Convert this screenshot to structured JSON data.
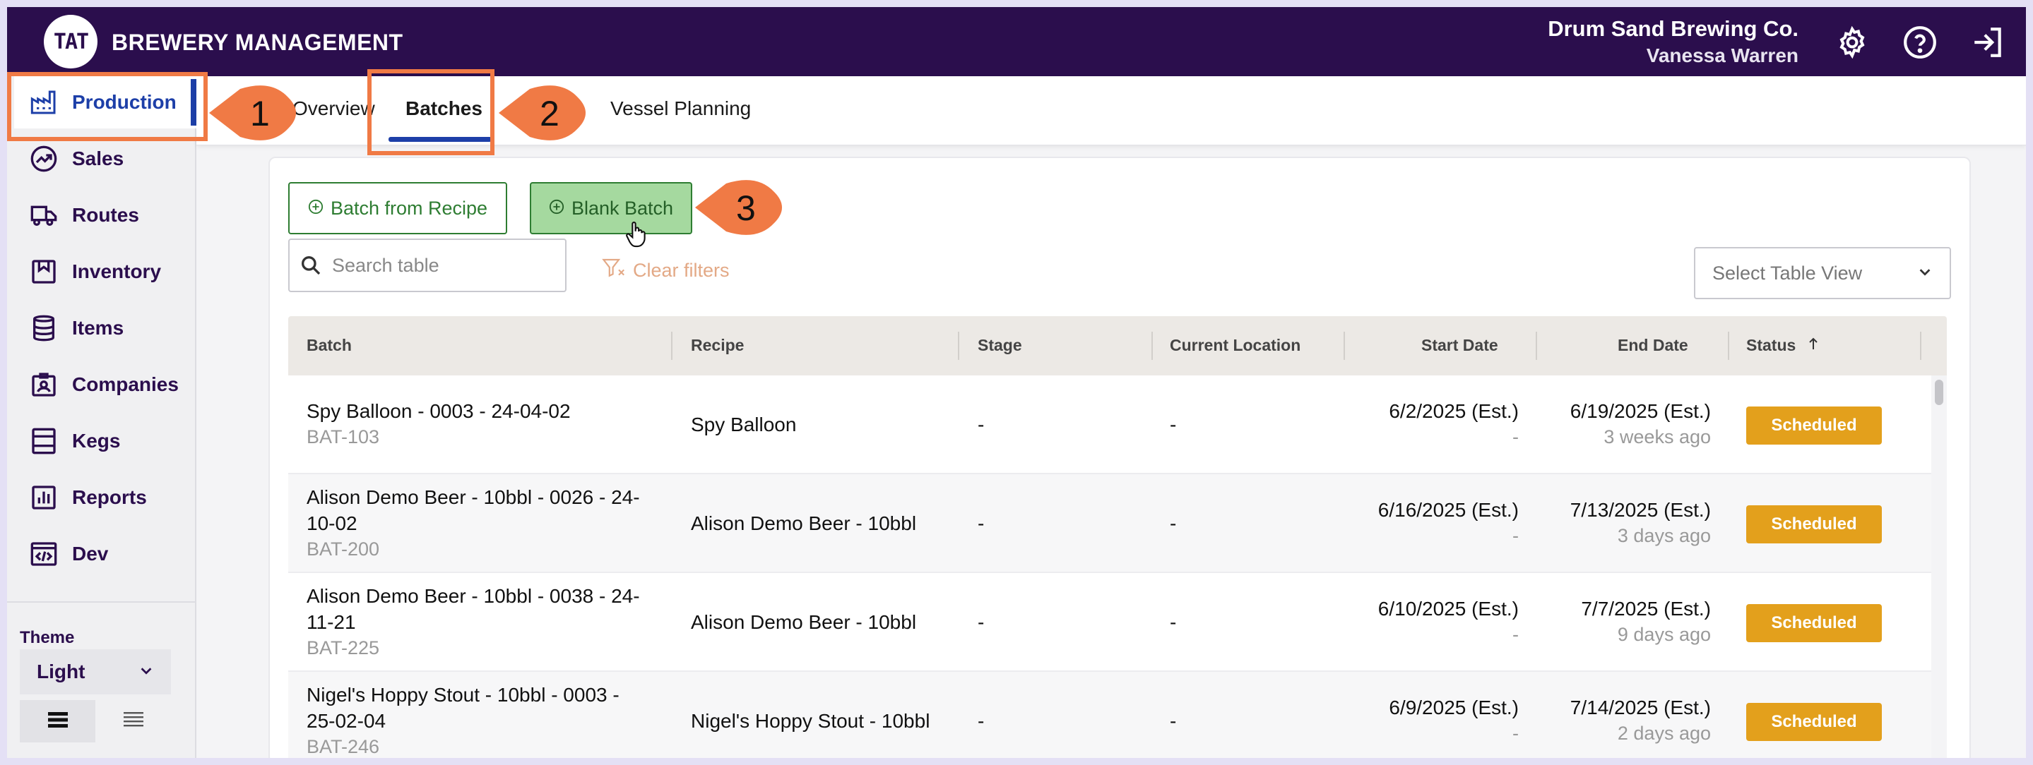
{
  "header": {
    "logo_text": "TAT",
    "app_title": "BREWERY MANAGEMENT",
    "company": "Drum Sand Brewing Co.",
    "user": "Vanessa Warren",
    "icons": [
      "settings-gear-icon",
      "help-question-icon",
      "logout-icon"
    ]
  },
  "sidebar": {
    "items": [
      {
        "label": "Production",
        "icon": "factory-icon"
      },
      {
        "label": "Sales",
        "icon": "trending-icon"
      },
      {
        "label": "Routes",
        "icon": "truck-icon"
      },
      {
        "label": "Inventory",
        "icon": "bookmark-box-icon"
      },
      {
        "label": "Items",
        "icon": "barrel-icon"
      },
      {
        "label": "Companies",
        "icon": "contact-card-icon"
      },
      {
        "label": "Kegs",
        "icon": "keg-icon"
      },
      {
        "label": "Reports",
        "icon": "bar-chart-icon"
      },
      {
        "label": "Dev",
        "icon": "code-window-icon"
      }
    ],
    "theme_label": "Theme",
    "theme_value": "Light"
  },
  "tabs": {
    "overview": "Overview",
    "batches": "Batches",
    "vessel_planning": "Vessel Planning"
  },
  "toolbar": {
    "batch_from_recipe": "Batch from Recipe",
    "blank_batch": "Blank Batch",
    "search_placeholder": "Search table",
    "clear_filters": "Clear filters",
    "table_view_placeholder": "Select Table View"
  },
  "table": {
    "columns": [
      "Batch",
      "Recipe",
      "Stage",
      "Current Location",
      "Start Date",
      "End Date",
      "Status"
    ],
    "rows": [
      {
        "batch_l1": "Spy Balloon - 0003 - 24-04-02",
        "batch_l2": "",
        "batch_id": "BAT-103",
        "recipe": "Spy Balloon",
        "stage": "-",
        "location": "-",
        "start": "6/2/2025 (Est.)",
        "start_sub": "-",
        "end": "6/19/2025 (Est.)",
        "end_sub": "3 weeks ago",
        "status": "Scheduled"
      },
      {
        "batch_l1": "Alison Demo Beer - 10bbl - 0026 - 24-",
        "batch_l2": "10-02",
        "batch_id": "BAT-200",
        "recipe": "Alison Demo Beer - 10bbl",
        "stage": "-",
        "location": "-",
        "start": "6/16/2025 (Est.)",
        "start_sub": "-",
        "end": "7/13/2025 (Est.)",
        "end_sub": "3 days ago",
        "status": "Scheduled"
      },
      {
        "batch_l1": "Alison Demo Beer - 10bbl - 0038 - 24-",
        "batch_l2": "11-21",
        "batch_id": "BAT-225",
        "recipe": "Alison Demo Beer - 10bbl",
        "stage": "-",
        "location": "-",
        "start": "6/10/2025 (Est.)",
        "start_sub": "-",
        "end": "7/7/2025 (Est.)",
        "end_sub": "9 days ago",
        "status": "Scheduled"
      },
      {
        "batch_l1": "Nigel's Hoppy Stout - 10bbl - 0003 -",
        "batch_l2": "25-02-04",
        "batch_id": "BAT-246",
        "recipe": "Nigel's Hoppy Stout - 10bbl",
        "stage": "-",
        "location": "-",
        "start": "6/9/2025 (Est.)",
        "start_sub": "-",
        "end": "7/14/2025 (Est.)",
        "end_sub": "2 days ago",
        "status": "Scheduled"
      }
    ]
  },
  "callouts": [
    "1",
    "2",
    "3"
  ],
  "colors": {
    "header_bg": "#2b0e4d",
    "accent_blue": "#1d3fa8",
    "green": "#2e7d32",
    "status_scheduled": "#e3a01c",
    "callout": "#f07a45"
  }
}
